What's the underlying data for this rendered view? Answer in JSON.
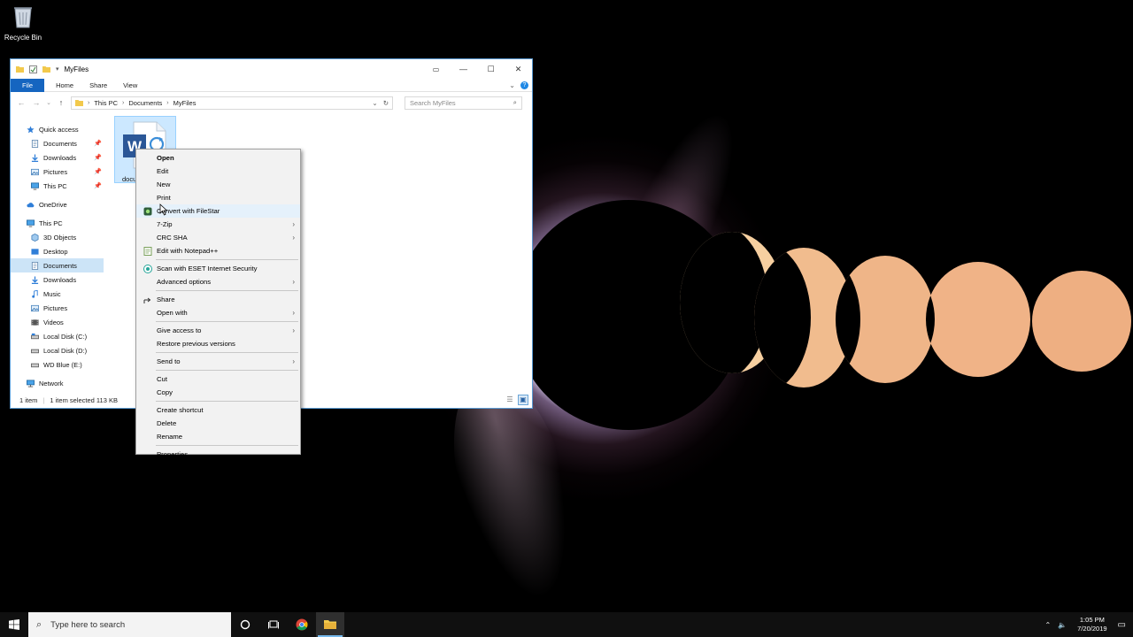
{
  "desktop": {
    "recycle_bin_label": "Recycle Bin"
  },
  "window": {
    "title": "MyFiles",
    "controls": {
      "minimize": "—",
      "maximize": "☐",
      "close": "✕"
    },
    "ribbon_tabs": [
      "File",
      "Home",
      "Share",
      "View"
    ],
    "breadcrumb": [
      "This PC",
      "Documents",
      "MyFiles"
    ],
    "search_placeholder": "Search MyFiles",
    "nav_pane": {
      "quick_access": "Quick access",
      "quick_items": [
        "Documents",
        "Downloads",
        "Pictures",
        "This PC"
      ],
      "onedrive": "OneDrive",
      "this_pc": "This PC",
      "pc_items": [
        "3D Objects",
        "Desktop",
        "Documents",
        "Downloads",
        "Music",
        "Pictures",
        "Videos",
        "Local Disk (C:)",
        "Local Disk (D:)",
        "WD Blue (E:)"
      ],
      "network": "Network"
    },
    "file": {
      "label": "docu"
    },
    "status": {
      "item_count": "1 item",
      "selection": "1 item selected  113 KB"
    }
  },
  "context_menu": {
    "open": "Open",
    "edit": "Edit",
    "new": "New",
    "print": "Print",
    "convert": "Convert with FileStar",
    "seven_zip": "7-Zip",
    "crc_sha": "CRC SHA",
    "notepad": "Edit with Notepad++",
    "eset": "Scan with ESET Internet Security",
    "advanced": "Advanced options",
    "share": "Share",
    "open_with": "Open with",
    "give_access": "Give access to",
    "restore": "Restore previous versions",
    "send_to": "Send to",
    "cut": "Cut",
    "copy": "Copy",
    "create_shortcut": "Create shortcut",
    "delete": "Delete",
    "rename": "Rename",
    "properties": "Properties"
  },
  "taskbar": {
    "search_placeholder": "Type here to search",
    "time": "1:05 PM",
    "date": "7/20/2019"
  },
  "colors": {
    "accent": "#1565c0",
    "selection": "#cce8ff",
    "menu_hover": "#e5f1fb"
  }
}
